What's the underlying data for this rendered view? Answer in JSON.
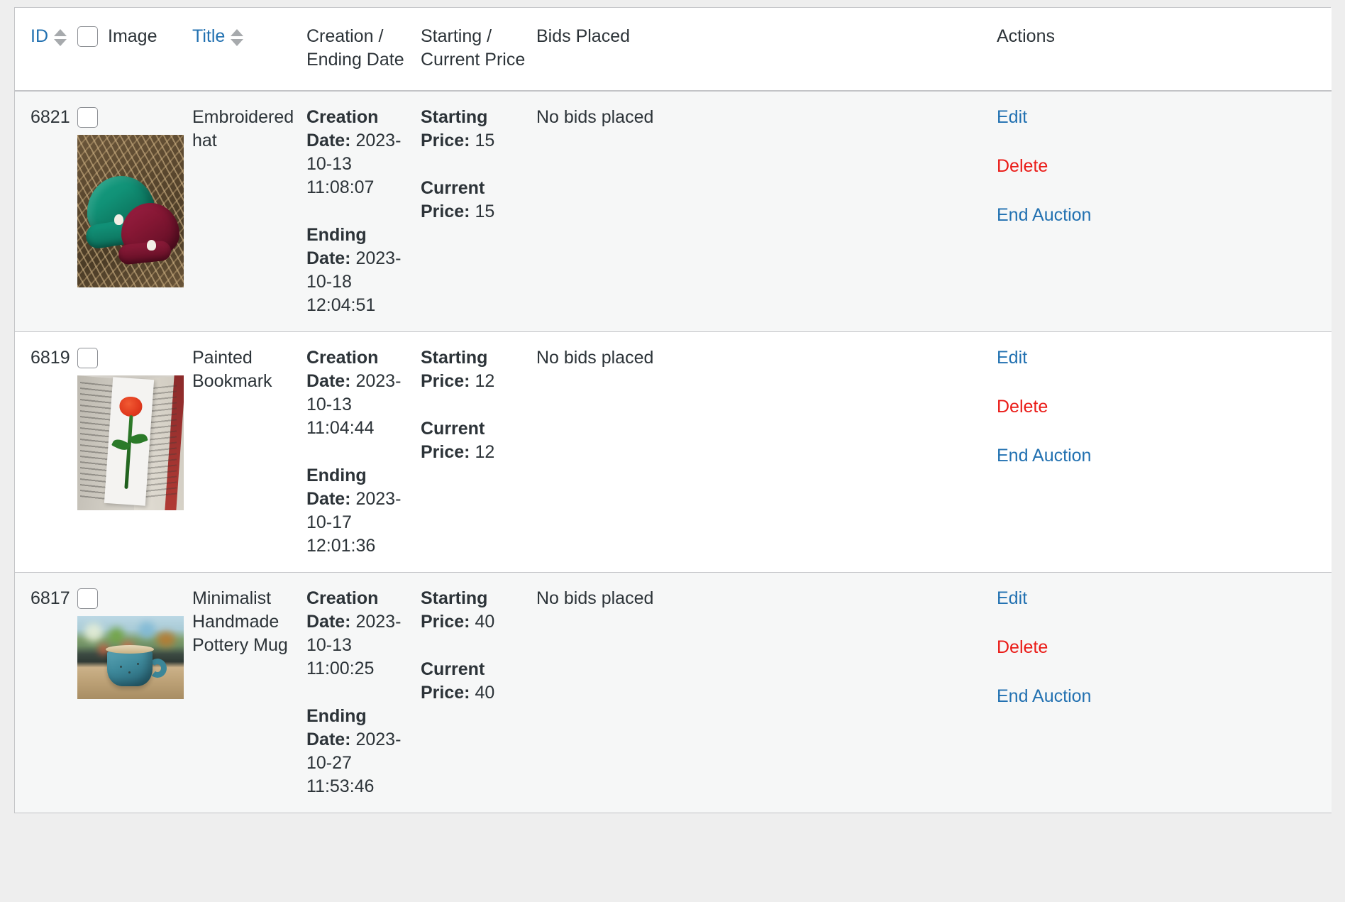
{
  "table": {
    "columns": [
      {
        "key": "id",
        "label": "ID",
        "sortable": true,
        "link": true
      },
      {
        "key": "image",
        "label": "Image",
        "sortable": false,
        "link": false,
        "has_checkbox": true
      },
      {
        "key": "title",
        "label": "Title",
        "sortable": true,
        "link": true
      },
      {
        "key": "dates",
        "label": "Creation / Ending Date",
        "sortable": false,
        "link": false
      },
      {
        "key": "price",
        "label": "Starting / Current Price",
        "sortable": false,
        "link": false
      },
      {
        "key": "bids",
        "label": "Bids Placed",
        "sortable": false,
        "link": false
      },
      {
        "key": "actions",
        "label": "Actions",
        "sortable": false,
        "link": false
      }
    ],
    "header": {
      "id_label": "ID",
      "image_label": "Image",
      "title_label": "Title",
      "dates_label": "Creation / Ending Date",
      "price_label": "Starting / Current Price",
      "bids_label": "Bids Placed",
      "actions_label": "Actions"
    },
    "field_labels": {
      "creation_date": "Creation Date:",
      "ending_date": "Ending Date:",
      "starting_price": "Starting Price:",
      "current_price": "Current Price:"
    },
    "action_labels": {
      "edit": "Edit",
      "delete": "Delete",
      "end_auction": "End Auction"
    },
    "rows": [
      {
        "id": "6821",
        "title": "Embroidered hat",
        "image_alt": "knit beanies on dry grass",
        "creation_date": "2023-10-13 11:08:07",
        "ending_date": "2023-10-18 12:04:51",
        "starting_price": "15",
        "current_price": "15",
        "bids": "No bids placed"
      },
      {
        "id": "6819",
        "title": "Painted Bookmark",
        "image_alt": "painted rose bookmark in an open book",
        "creation_date": "2023-10-13 11:04:44",
        "ending_date": "2023-10-17 12:01:36",
        "starting_price": "12",
        "current_price": "12",
        "bids": "No bids placed"
      },
      {
        "id": "6817",
        "title": "Minimalist Handmade Pottery Mug",
        "image_alt": "teal pottery mug on a wooden table",
        "creation_date": "2023-10-13 11:00:25",
        "ending_date": "2023-10-27 11:53:46",
        "starting_price": "40",
        "current_price": "40",
        "bids": "No bids placed"
      }
    ]
  },
  "colors": {
    "link": "#2271b1",
    "danger": "#ea1b17",
    "text": "#2c3338",
    "row_alt_bg": "#f6f7f7",
    "border": "#c3c4c7",
    "page_bg": "#eeeeee"
  }
}
